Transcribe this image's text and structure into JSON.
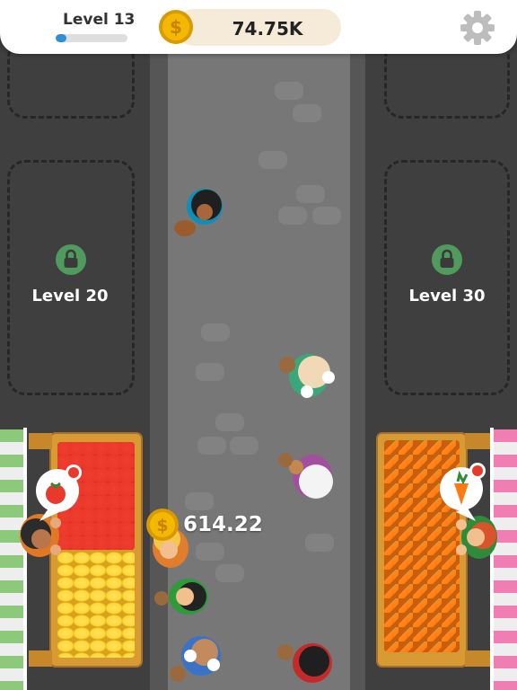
{
  "hud": {
    "level_label": "Level 13",
    "level_progress": 0.15,
    "coins": "74.75K",
    "coin_icon": "dollar-coin-icon",
    "settings_icon": "gear-icon"
  },
  "plots": [
    {
      "label": "Level 20",
      "icon": "lock-icon"
    },
    {
      "label": "Level 30",
      "icon": "lock-icon"
    }
  ],
  "stalls": {
    "left": {
      "produce": [
        "tomato",
        "banana"
      ],
      "request_icon": "tomato-icon"
    },
    "right": {
      "produce": [
        "carrot"
      ],
      "request_icon": "carrot-icon"
    }
  },
  "earning": {
    "amount": "614.22",
    "icon": "dollar-coin-icon"
  },
  "colors": {
    "road": "#777777",
    "sidewalk": "#3f3f3f",
    "wood": "#d89a33",
    "coin": "#f5b800",
    "xp_bar": "#2f8ed6",
    "lock": "#4f9a5c",
    "awning_left": "#8dc97a",
    "awning_right": "#f07eb3"
  }
}
